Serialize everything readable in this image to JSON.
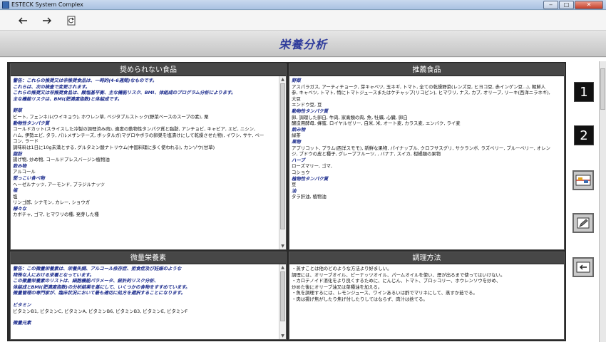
{
  "window": {
    "title": "ESTECK System Complex",
    "buttons": [
      "‒",
      "□",
      "✕"
    ]
  },
  "toolbar": {
    "back_icon": "arrow-left-icon",
    "forward_icon": "arrow-right-icon",
    "refresh_icon": "refresh-icon"
  },
  "header": {
    "title": "栄養分析"
  },
  "panels": {
    "not_recommended": {
      "title": "奨められない食品",
      "lines": [
        {
          "t": "warn",
          "v": "警告：これらの推奨又は非推奨食品は、一時的(4-6週間)なものです。"
        },
        {
          "t": "warn",
          "v": "これらは、次の検査で変更されます。"
        },
        {
          "t": "warn",
          "v": "これらの推奨又は非推奨食品は、酸塩基平衡、主な機能リスク、BMI、体組成のプログラム分析によります。"
        },
        {
          "t": "warn",
          "v": "主な機能リスクは、BMI(肥満度指数)と体組成です。"
        },
        {
          "t": "gap",
          "v": ""
        },
        {
          "t": "head",
          "v": "野菜"
        },
        {
          "t": "txt",
          "v": "ビート, フェンネル(ウイキョウ), ホウレン草, ベジタブルストック(野菜ベースのスープの素), 栗"
        },
        {
          "t": "head",
          "v": "動物性タンパク質"
        },
        {
          "t": "txt",
          "v": "コールドカット(スライスした冷製の調理済み肉), 適度の動物性タンパク質と脂肪, アンチョビ, キャビア, エビ, ニシン,"
        },
        {
          "t": "txt",
          "v": "ハム, 伊勢エビ, タラ, パルメザンチーズ, ボッタルガ(マグロやボラの卵巣を塩漬けにして乾燥させた物), イワシ, サケ, ベー"
        },
        {
          "t": "txt",
          "v": "コン, ラード"
        },
        {
          "t": "txt",
          "v": "調味料は1日に10g未満とする, グルタミン酸ナトリウム(中国料理に多く使われる), カンゾウ(甘草)"
        },
        {
          "t": "head",
          "v": "脂肪"
        },
        {
          "t": "txt",
          "v": "揚げ物, 炒め物, コールドプレスバージン植物油"
        },
        {
          "t": "head",
          "v": "飲み物"
        },
        {
          "t": "txt",
          "v": "アルコール"
        },
        {
          "t": "head",
          "v": "堅っこい食べ物"
        },
        {
          "t": "txt",
          "v": "ヘーゼルナッツ, アーモンド, ブラジルナッツ"
        },
        {
          "t": "head",
          "v": "塩"
        },
        {
          "t": "txt",
          "v": "塩"
        },
        {
          "t": "txt",
          "v": "リンゴ酢, シナモン, カレー, ショウガ"
        },
        {
          "t": "head",
          "v": "様々な"
        },
        {
          "t": "txt",
          "v": "カボチャ, ゴマ, ヒマワリの種, 発芽した種"
        }
      ]
    },
    "recommended": {
      "title": "推薦食品",
      "lines": [
        {
          "t": "head",
          "v": "野菜"
        },
        {
          "t": "txt",
          "v": "アスパラガス, アーティチョーク, 芽キャベツ, 玉ネギ, トマト, 全ての乾燥野菜(レンズ豆, ヒヨコ豆, 赤インゲン豆…), 朝鮮人"
        },
        {
          "t": "txt",
          "v": "参, キャベツ, トマト, 特にトマトジュースまたはケチャップ(リコピン), ヒマワリ, ナス, カブ, オリーブ, リーキ(西洋ニラネギ),"
        },
        {
          "t": "txt",
          "v": "大豆"
        },
        {
          "t": "txt",
          "v": "エンドウ豆, 豆"
        },
        {
          "t": "head",
          "v": "動物性タンパク質"
        },
        {
          "t": "txt",
          "v": "卵, 調理した卵白, 牛肉, 家禽類の肉, 魚, 牡蠣, 心臓, 卵白"
        },
        {
          "t": "txt",
          "v": "醸造用酵母, 蜂蜜, ロイヤルゼリー, 白米, 米, オート麦, カラス麦, エンバク, ライ麦"
        },
        {
          "t": "head",
          "v": "飲み物"
        },
        {
          "t": "txt",
          "v": "緑茶"
        },
        {
          "t": "head",
          "v": "果物"
        },
        {
          "t": "txt",
          "v": "アプリコット, プラム(西洋スモモ), 新鮮な果物, パイナップル, クロフサスグリ, サクランボ, ラズベリー, ブルーベリー, オレン"
        },
        {
          "t": "txt",
          "v": "ジ, ブドウの皮と種子, グレープフルーツ, , バナナ, スイカ, 柑橘類の果物"
        },
        {
          "t": "head",
          "v": "ハーブ"
        },
        {
          "t": "txt",
          "v": "ローズマリー, ゴマ,"
        },
        {
          "t": "txt",
          "v": "コショウ"
        },
        {
          "t": "head",
          "v": "植物性タンパク質"
        },
        {
          "t": "txt",
          "v": "豆"
        },
        {
          "t": "head",
          "v": "油"
        },
        {
          "t": "txt",
          "v": "タラ肝油, 植物油"
        }
      ]
    },
    "micronutrients": {
      "title": "微量栄養素",
      "lines": [
        {
          "t": "warn",
          "v": "警告：この微量栄養素は、栄養失調、アルコール依存症、拒食症及び妊娠のような"
        },
        {
          "t": "warn",
          "v": "特殊な人における栄養となっています。"
        },
        {
          "t": "warn",
          "v": "この微量栄養素のリストは、細胞機能パラメータ、統計的リスク分析、"
        },
        {
          "t": "warn",
          "v": "体組成とBMI(肥満度指数)の分析結果を基にして、いくつかの食物をすすめています。"
        },
        {
          "t": "warn",
          "v": "微量管理の専門家が、臨床状況において最も適切に処方を選択することになります。"
        },
        {
          "t": "gap",
          "v": ""
        },
        {
          "t": "head",
          "v": "ビタミン"
        },
        {
          "t": "txt",
          "v": "ビタミンB1, ビタミンC, ビタミンA, ビタミンB6, ビタミンB3, ビタミンE, ビタミンF"
        },
        {
          "t": "gap",
          "v": ""
        },
        {
          "t": "head",
          "v": "微量元素"
        }
      ]
    },
    "cooking": {
      "title": "調理方法",
      "lines": [
        {
          "t": "txt",
          "v": "・蒸すことは他のどのような方法より好ましい。"
        },
        {
          "t": "txt",
          "v": "調理には、オリーブオイル、ピーナッツオイル、パームオイルを使い、煙が出るまで使ってはいけない。"
        },
        {
          "t": "txt",
          "v": "・カロテノイド消化をより良くするために、にんじん、トマト、ブロッコリー、ホウレンソウを炒め、"
        },
        {
          "t": "txt",
          "v": "炒めた後にオリーブ油又は菜種油を加える。"
        },
        {
          "t": "txt",
          "v": "・魚を調理するには、レモンジュース、ワインあるいは酢でマリネにして、蒸すか茹でる。"
        },
        {
          "t": "txt",
          "v": "・肉は揚げ焦がしたり焦げ付したりしてはならず、肉汁は捨てる。"
        }
      ]
    }
  },
  "side_buttons": {
    "b1": "1",
    "b2": "2",
    "b3_icon": "balance-chart-icon",
    "b4_icon": "edit-pen-icon",
    "b5_icon": "return-arrow-icon"
  }
}
